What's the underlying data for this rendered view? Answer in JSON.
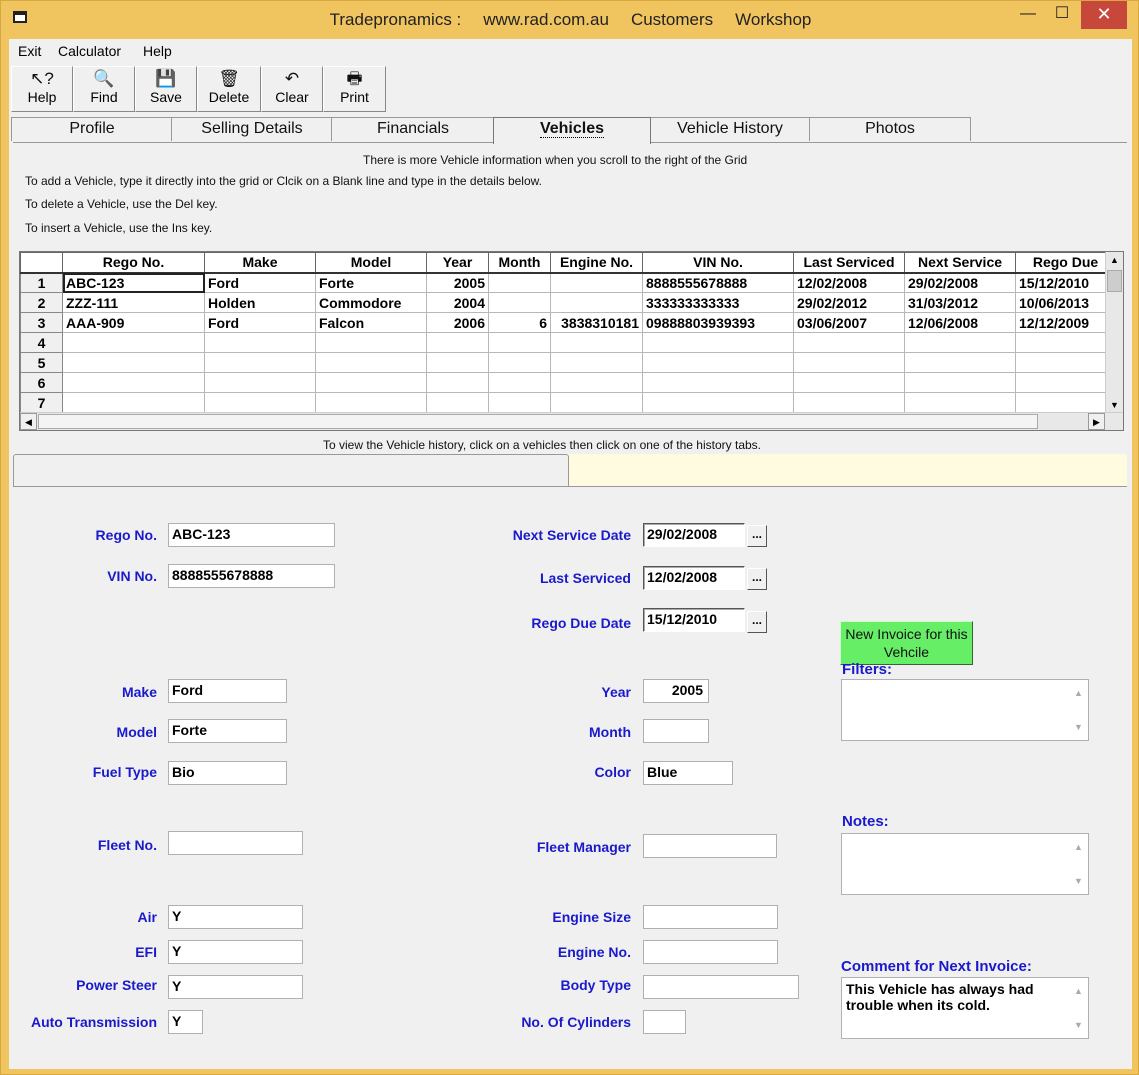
{
  "titlebar": {
    "parts": [
      "Tradepronamics :",
      "www.rad.com.au",
      "Customers",
      "Workshop"
    ],
    "min": "—",
    "max": "☐",
    "close": "✕"
  },
  "menu": [
    "Exit",
    "Calculator",
    "Help"
  ],
  "toolbar": [
    {
      "label": "Help",
      "icon": "help-pointer-icon",
      "glyph": "↖?"
    },
    {
      "label": "Find",
      "icon": "find-document-icon",
      "glyph": "🔍"
    },
    {
      "label": "Save",
      "icon": "floppy-disk-icon",
      "glyph": "💾"
    },
    {
      "label": "Delete",
      "icon": "trash-can-icon",
      "glyph": "🗑"
    },
    {
      "label": "Clear",
      "icon": "undo-arrow-icon",
      "glyph": "↶"
    },
    {
      "label": "Print",
      "icon": "printer-icon",
      "glyph": "🖶"
    }
  ],
  "tabs": [
    "Profile",
    "Selling Details",
    "Financials",
    "Vehicles",
    "Vehicle History",
    "Photos"
  ],
  "active_tab": "Vehicles",
  "info": {
    "scroll_note": "There is more Vehicle information when you scroll to the right of the Grid",
    "add_note": "To add a Vehicle, type it directly into the grid or Clcik on a Blank line and type in the details below.",
    "delete_note": "To delete a Vehicle, use the Del key.",
    "insert_note": "To insert a Vehicle, use the Ins key.",
    "history_note": "To view the Vehicle history, click on a vehicles then click on one of the history tabs."
  },
  "grid": {
    "columns": [
      "Rego No.",
      "Make",
      "Model",
      "Year",
      "Month",
      "Engine No.",
      "VIN No.",
      "Last Serviced",
      "Next Service",
      "Rego Due"
    ],
    "rows": [
      {
        "num": "1",
        "cells": [
          "ABC-123",
          "Ford",
          "Forte",
          "2005",
          "",
          "",
          "8888555678888",
          "12/02/2008",
          "29/02/2008",
          "15/12/2010"
        ]
      },
      {
        "num": "2",
        "cells": [
          "ZZZ-111",
          "Holden",
          "Commodore",
          "2004",
          "",
          "",
          "333333333333",
          "29/02/2012",
          "31/03/2012",
          "10/06/2013"
        ]
      },
      {
        "num": "3",
        "cells": [
          "AAA-909",
          "Ford",
          "Falcon",
          "2006",
          "6",
          "3838310181",
          "09888803939393",
          "03/06/2007",
          "12/06/2008",
          "12/12/2009"
        ]
      },
      {
        "num": "4",
        "cells": [
          "",
          "",
          "",
          "",
          "",
          "",
          "",
          "",
          "",
          ""
        ]
      },
      {
        "num": "5",
        "cells": [
          "",
          "",
          "",
          "",
          "",
          "",
          "",
          "",
          "",
          ""
        ]
      },
      {
        "num": "6",
        "cells": [
          "",
          "",
          "",
          "",
          "",
          "",
          "",
          "",
          "",
          ""
        ]
      },
      {
        "num": "7",
        "cells": [
          "",
          "",
          "",
          "",
          "",
          "",
          "",
          "",
          "",
          ""
        ]
      }
    ]
  },
  "form": {
    "rego_label": "Rego No.",
    "rego": "ABC-123",
    "vin_label": "VIN No.",
    "vin": "8888555678888",
    "next_service_label": "Next Service Date",
    "next_service": "29/02/2008",
    "last_serviced_label": "Last Serviced",
    "last_serviced": "12/02/2008",
    "rego_due_label": "Rego Due Date",
    "rego_due": "15/12/2010",
    "date_btn": "...",
    "new_invoice": "New Invoice for this Vehcile",
    "make_label": "Make",
    "make": "Ford",
    "model_label": "Model",
    "model": "Forte",
    "fuel_label": "Fuel Type",
    "fuel": "Bio",
    "year_label": "Year",
    "year": "2005",
    "month_label": "Month",
    "month": "",
    "color_label": "Color",
    "color": "Blue",
    "filters_label": "Filters:",
    "filters": "",
    "fleet_no_label": "Fleet No.",
    "fleet_no": "",
    "fleet_manager_label": "Fleet Manager",
    "fleet_manager": "",
    "notes_label": "Notes:",
    "notes": "",
    "air_label": "Air",
    "air": "Y",
    "efi_label": "EFI",
    "efi": "Y",
    "power_steer_label": "Power Steer",
    "power_steer": "Y",
    "auto_trans_label": "Auto Transmission",
    "auto_trans": "Y",
    "engine_size_label": "Engine Size",
    "engine_size": "",
    "engine_no_label": "Engine No.",
    "engine_no": "",
    "body_type_label": "Body Type",
    "body_type": "",
    "cylinders_label": "No. Of Cylinders",
    "cylinders": "",
    "comment_label": "Comment for Next Invoice:",
    "comment": "This Vehicle has always had trouble when its cold."
  },
  "colors": {
    "window_frame": "#f0c560",
    "label_blue": "#1a1acc",
    "invoice_green": "#66ee66",
    "close_red": "#c7473a"
  }
}
